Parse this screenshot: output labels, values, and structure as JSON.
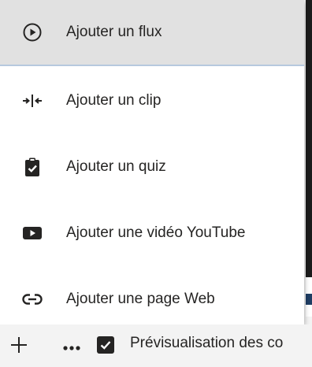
{
  "menu": {
    "items": [
      {
        "label": "Ajouter un flux",
        "icon": "play-circle-icon",
        "selected": true
      },
      {
        "label": "Ajouter un clip",
        "icon": "clip-icon"
      },
      {
        "label": "Ajouter un quiz",
        "icon": "clipboard-check-icon"
      },
      {
        "label": "Ajouter une vidéo YouTube",
        "icon": "youtube-icon"
      },
      {
        "label": "Ajouter une page Web",
        "icon": "link-icon"
      }
    ]
  },
  "toolbar": {
    "add_icon": "plus-icon",
    "more_icon": "ellipsis-icon",
    "preview_checked": true,
    "preview_label": "Prévisualisation des co"
  },
  "colors": {
    "text": "#252423",
    "selected_bg": "#e1e1e1",
    "selected_border": "#b6c9de"
  }
}
